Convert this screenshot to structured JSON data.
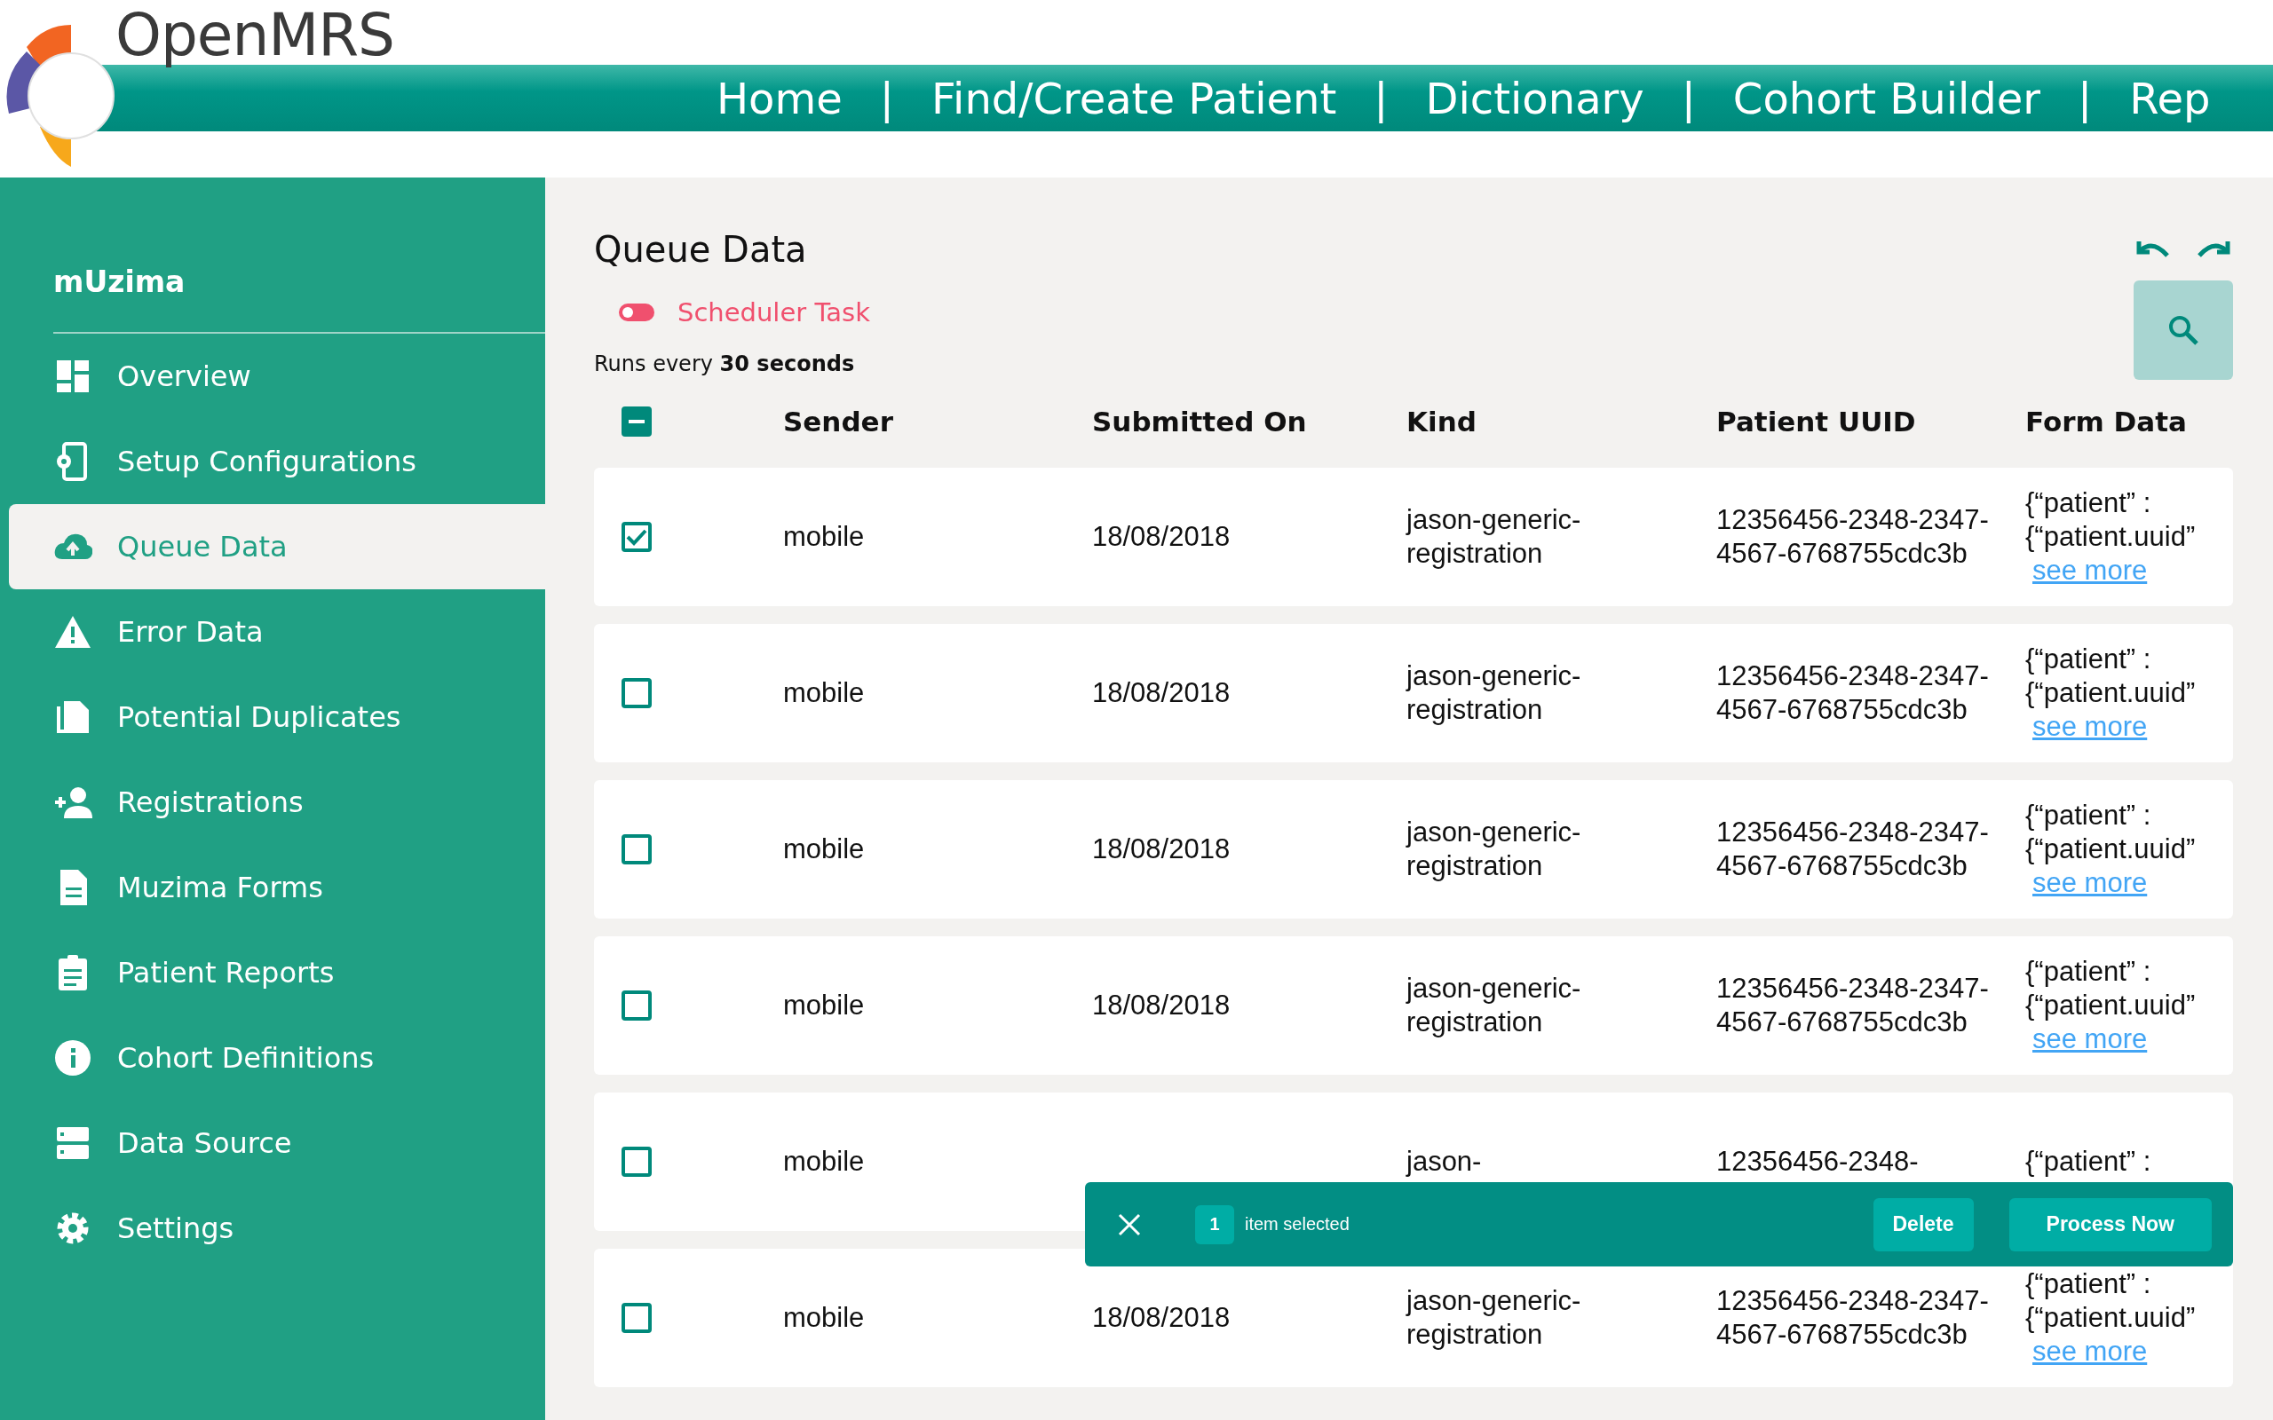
{
  "header": {
    "brand": "OpenMRS",
    "nav": [
      {
        "kind": "link",
        "text": "Home"
      },
      {
        "kind": "separator",
        "text": "|"
      },
      {
        "kind": "link",
        "text": "Find/Create Patient"
      },
      {
        "kind": "separator",
        "text": "|"
      },
      {
        "kind": "link",
        "text": "Dictionary"
      },
      {
        "kind": "separator",
        "text": "|"
      },
      {
        "kind": "link",
        "text": "Cohort Builder"
      },
      {
        "kind": "separator",
        "text": "|"
      },
      {
        "kind": "link",
        "text": "Rep"
      }
    ]
  },
  "sidebar": {
    "title": "mUzima",
    "items": [
      {
        "label": "Overview",
        "selected": false
      },
      {
        "label": "Setup Configurations",
        "selected": false
      },
      {
        "label": "Queue Data",
        "selected": true
      },
      {
        "label": "Error Data",
        "selected": false
      },
      {
        "label": "Potential Duplicates",
        "selected": false
      },
      {
        "label": "Registrations",
        "selected": false
      },
      {
        "label": "Muzima Forms",
        "selected": false
      },
      {
        "label": "Patient Reports",
        "selected": false
      },
      {
        "label": "Cohort Definitions",
        "selected": false
      },
      {
        "label": "Data Source",
        "selected": false
      },
      {
        "label": "Settings",
        "selected": false
      }
    ]
  },
  "page": {
    "title": "Queue Data",
    "scheduler": {
      "label": "Scheduler Task",
      "on": false
    },
    "schedule_text": "Runs every **30 seconds**"
  },
  "table": {
    "select_all": {
      "indeterminate": true
    },
    "columns": [
      "Sender",
      "Submitted On",
      "Kind",
      "Patient UUID",
      "Form Data"
    ],
    "rows": [
      {
        "selected": true,
        "sender": "mobile",
        "submitted_on": "18/08/2018",
        "kind": "jason-generic-registration",
        "patient_uuid": "12356456-2348-2347-4567-6768755cdc3b",
        "form_data": "{“patient” : {“patient.uuid”",
        "link": "see more"
      },
      {
        "selected": false,
        "sender": "mobile",
        "submitted_on": "18/08/2018",
        "kind": "jason-generic-registration",
        "patient_uuid": "12356456-2348-2347-4567-6768755cdc3b",
        "form_data": "{“patient” : {“patient.uuid”",
        "link": "see more"
      },
      {
        "selected": false,
        "sender": "mobile",
        "submitted_on": "18/08/2018",
        "kind": "jason-generic-registration",
        "patient_uuid": "12356456-2348-2347-4567-6768755cdc3b",
        "form_data": "{“patient” : {“patient.uuid”",
        "link": "see more"
      },
      {
        "selected": false,
        "sender": "mobile",
        "submitted_on": "18/08/2018",
        "kind": "jason-generic-registration",
        "patient_uuid": "12356456-2348-2347-4567-6768755cdc3b",
        "form_data": "{“patient” : {“patient.uuid”",
        "link": "see more"
      },
      {
        "selected": false,
        "sender": "mobile",
        "kind": "jason-",
        "patient_uuid": "12356456-2348-",
        "form_data": "{“patient” :"
      },
      {
        "selected": false,
        "sender": "mobile",
        "submitted_on": "18/08/2018",
        "kind": "jason-generic-registration",
        "patient_uuid": "12356456-2348-2347-4567-6768755cdc3b",
        "form_data": "{“patient” : {“patient.uuid”",
        "link": "see more"
      }
    ]
  },
  "action_bar": {
    "count": "1",
    "label": "item selected",
    "buttons": [
      "Delete",
      "Process Now"
    ]
  }
}
